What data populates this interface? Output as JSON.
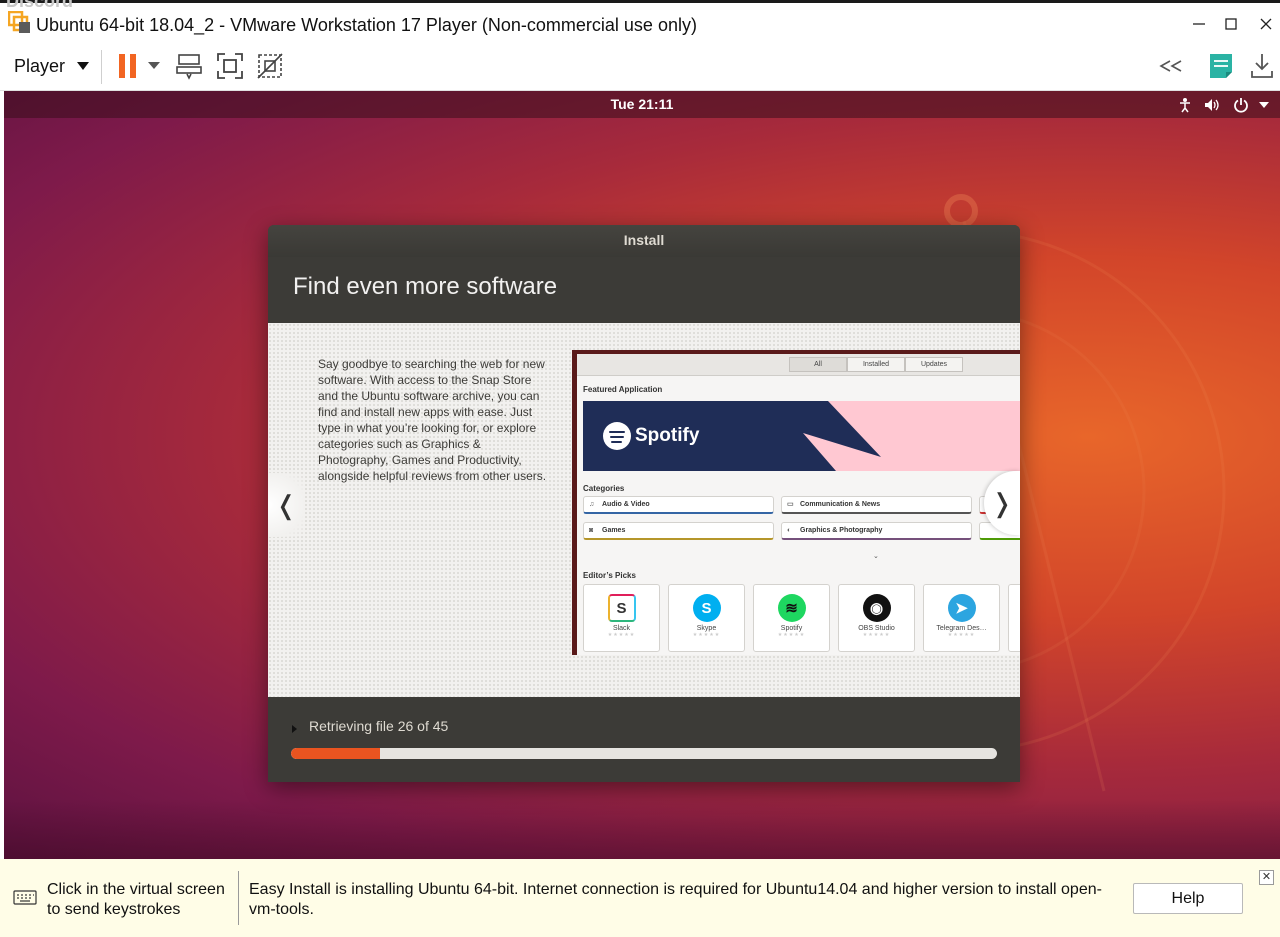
{
  "window": {
    "background_text": "Discord",
    "title": "Ubuntu 64-bit 18.04_2 - VMware Workstation 17 Player (Non-commercial use only)",
    "controls": {
      "minimize": "—",
      "maximize": "☐",
      "close": "✕"
    }
  },
  "toolbar": {
    "player_label": "Player"
  },
  "vm": {
    "topbar": {
      "clock": "Tue 21:11",
      "tray_icons": [
        "accessibility-icon",
        "volume-icon",
        "power-icon",
        "chevron-down-icon"
      ]
    },
    "installer": {
      "window_title": "Install",
      "heading": "Find even more software",
      "description": "Say goodbye to searching the web for new software. With access to the Snap Store and the Ubuntu software archive, you can find and install new apps with ease. Just type in what you’re looking for, or explore categories such as Graphics & Photography, Games and Productivity, alongside helpful reviews from other users.",
      "prev_arrow": "❬",
      "next_arrow": "❭",
      "screenshot": {
        "tabs": [
          "All",
          "Installed",
          "Updates"
        ],
        "featured_label": "Featured Application",
        "featured_app": "Spotify",
        "categories_label": "Categories",
        "categories": [
          "Audio & Video",
          "Communication & News",
          "Games",
          "Graphics & Photography"
        ],
        "expand_glyph": "⌄",
        "picks_label": "Editor’s Picks",
        "picks": [
          {
            "name": "Slack",
            "glyph": "S"
          },
          {
            "name": "Skype",
            "glyph": "S"
          },
          {
            "name": "Spotify",
            "glyph": "≋"
          },
          {
            "name": "OBS Studio",
            "glyph": "◉"
          },
          {
            "name": "Telegram Des…",
            "glyph": "➤"
          }
        ],
        "stars": "★★★★★"
      },
      "progress": {
        "status": "Retrieving file 26 of 45",
        "fraction": 0.126
      }
    }
  },
  "infobar": {
    "hint": "Click in the virtual screen to send keystrokes",
    "message": "Easy Install is installing Ubuntu 64-bit. Internet connection is required for Ubuntu14.04 and higher version to install open-vm-tools.",
    "help_label": "Help",
    "close_glyph": "✕"
  },
  "colors": {
    "accent_orange": "#e95420",
    "installer_dark": "#3c3b37",
    "infobar_bg": "#fffde7",
    "pause_orange": "#f26522"
  }
}
